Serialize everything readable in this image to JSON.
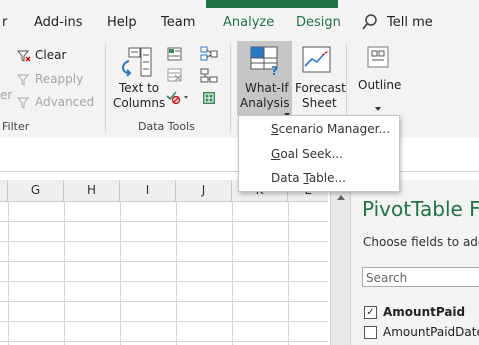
{
  "tabs": {
    "file_partial": "r",
    "addins": "Add-ins",
    "help": "Help",
    "team": "Team",
    "analyze": "Analyze",
    "design": "Design",
    "tell_me": "Tell me"
  },
  "ribbon": {
    "sort_filter": {
      "partial_label": "er",
      "clear": "Clear",
      "reapply": "Reapply",
      "advanced": "Advanced",
      "group_label": "Filter"
    },
    "data_tools": {
      "text_to_columns_line1": "Text to",
      "text_to_columns_line2": "Columns",
      "group_label": "Data Tools"
    },
    "forecast": {
      "what_if_line1": "What-If",
      "what_if_line2": "Analysis",
      "forecast_line1": "Forecast",
      "forecast_line2": "Sheet"
    },
    "outline": {
      "label": "Outline"
    }
  },
  "whatif_menu": {
    "items": [
      "Scenario Manager...",
      "Goal Seek...",
      "Data Table..."
    ]
  },
  "grid": {
    "columns": [
      "G",
      "H",
      "I",
      "J",
      "K",
      "L"
    ]
  },
  "pivot_pane": {
    "title": "PivotTable Fi",
    "subtitle": "Choose fields to add to",
    "search_placeholder": "Search",
    "fields": [
      {
        "label": "AmountPaid",
        "checked": true,
        "bold": true
      },
      {
        "label": "AmountPaidDate",
        "checked": false,
        "bold": false
      }
    ]
  },
  "colors": {
    "accent": "#217346",
    "ribbon_bg": "#f3f3f3",
    "pressed": "#c6c6c6"
  }
}
